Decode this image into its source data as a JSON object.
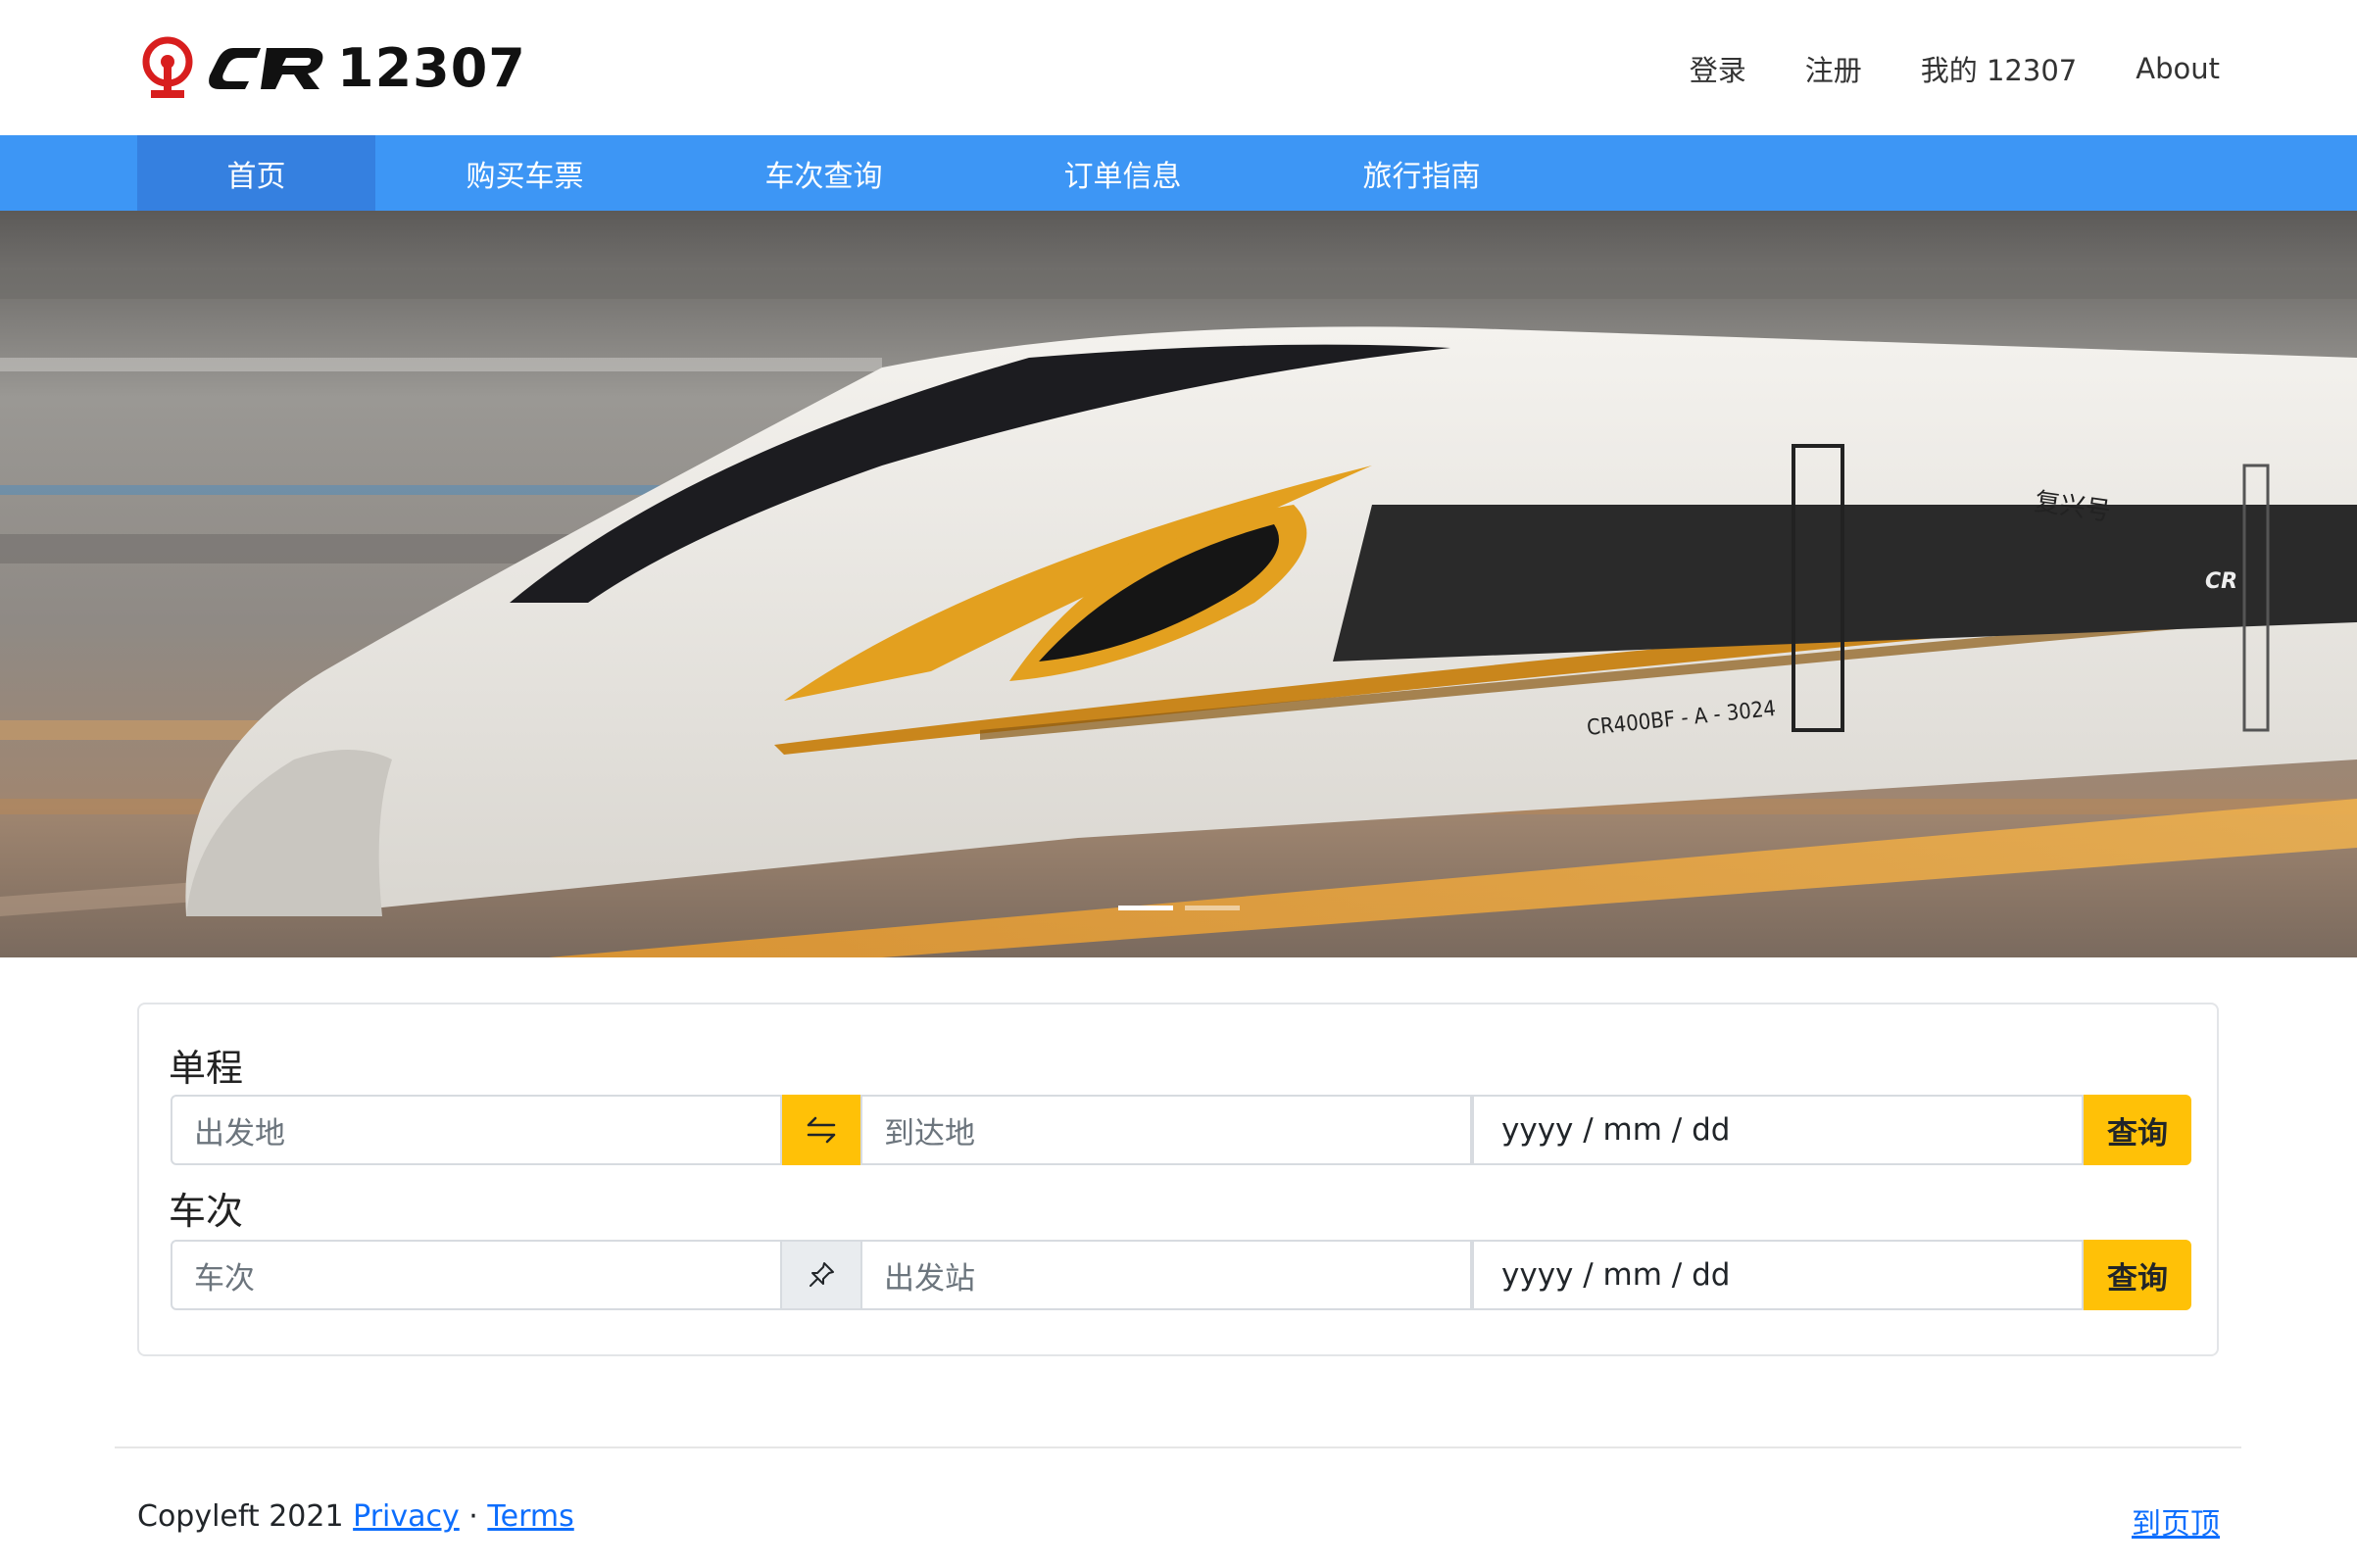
{
  "brand": {
    "name": "12307"
  },
  "top_links": [
    {
      "label": "登录"
    },
    {
      "label": "注册"
    },
    {
      "label": "我的 12307"
    },
    {
      "label": "About"
    }
  ],
  "nav": {
    "items": [
      {
        "label": "首页",
        "active": true
      },
      {
        "label": "购买车票",
        "active": false
      },
      {
        "label": "车次查询",
        "active": false
      },
      {
        "label": "订单信息",
        "active": false
      },
      {
        "label": "旅行指南",
        "active": false
      }
    ],
    "color": "#3d96f5"
  },
  "hero": {
    "train_code": "CR400BF - A - 3024",
    "train_name": "复兴号",
    "train_logo": "CR",
    "slides_count": 2,
    "active_slide": 1
  },
  "search": {
    "one_way": {
      "title": "单程",
      "from_placeholder": "出发地",
      "swap_icon": "swap-arrows-icon",
      "to_placeholder": "到达地",
      "date_placeholder": "yyyy / mm / dd",
      "query_label": "查询"
    },
    "by_train": {
      "title": "车次",
      "train_placeholder": "车次",
      "pin_icon": "pin-icon",
      "station_placeholder": "出发站",
      "date_placeholder": "yyyy / mm / dd",
      "query_label": "查询"
    },
    "accent": "#ffc107"
  },
  "footer": {
    "copyleft": "Copyleft 2021",
    "privacy": "Privacy",
    "separator": "·",
    "terms": "Terms",
    "back_to_top": "到页顶"
  }
}
